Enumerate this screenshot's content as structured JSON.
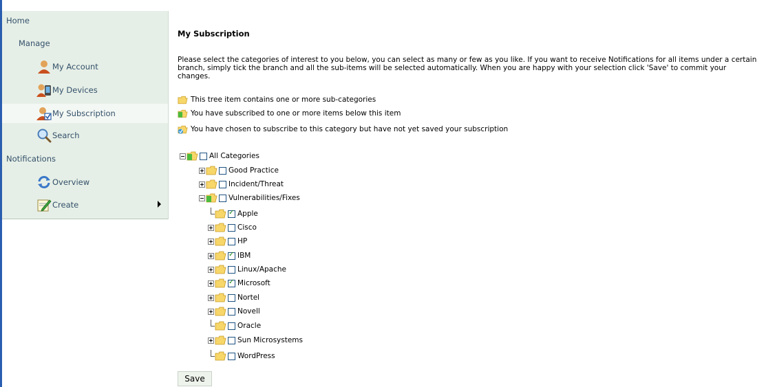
{
  "sidebar": {
    "home": "Home",
    "manage": "Manage",
    "notifications": "Notifications",
    "items": [
      {
        "label": "My Account",
        "icon": "user-icon"
      },
      {
        "label": "My Devices",
        "icon": "devices-icon"
      },
      {
        "label": "My Subscription",
        "icon": "subscription-icon"
      },
      {
        "label": "Search",
        "icon": "search-icon"
      },
      {
        "label": "Overview",
        "icon": "refresh-icon"
      },
      {
        "label": "Create",
        "icon": "pencil-icon"
      }
    ]
  },
  "main": {
    "title": "My Subscription",
    "intro": "Please select the categories of interest to you below, you can select as many or few as you like. If you want to receive Notifications for all items under a certain branch, simply tick the branch and all the sub-items will be selected automatically. When you are happy with your selection click 'Save' to commit your changes.",
    "legend": [
      "This tree item contains one or more sub-categories",
      "You have subscribed to one or more items below this item",
      "You have chosen to subscribe to this category but have not yet saved your subscription"
    ],
    "tree": {
      "root": {
        "label": "All Categories",
        "checked": false
      },
      "level1": [
        {
          "label": "Good Practice",
          "checked": false
        },
        {
          "label": "Incident/Threat",
          "checked": false
        },
        {
          "label": "Vulnerabilities/Fixes",
          "checked": false
        }
      ],
      "vendors": [
        {
          "label": "Apple",
          "checked": true
        },
        {
          "label": "Cisco",
          "checked": false
        },
        {
          "label": "HP",
          "checked": false
        },
        {
          "label": "IBM",
          "checked": true
        },
        {
          "label": "Linux/Apache",
          "checked": false
        },
        {
          "label": "Microsoft",
          "checked": true
        },
        {
          "label": "Nortel",
          "checked": false
        },
        {
          "label": "Novell",
          "checked": false
        },
        {
          "label": "Oracle",
          "checked": false
        },
        {
          "label": "Sun Microsystems",
          "checked": false
        },
        {
          "label": "WordPress",
          "checked": false
        }
      ]
    },
    "save_label": "Save"
  }
}
